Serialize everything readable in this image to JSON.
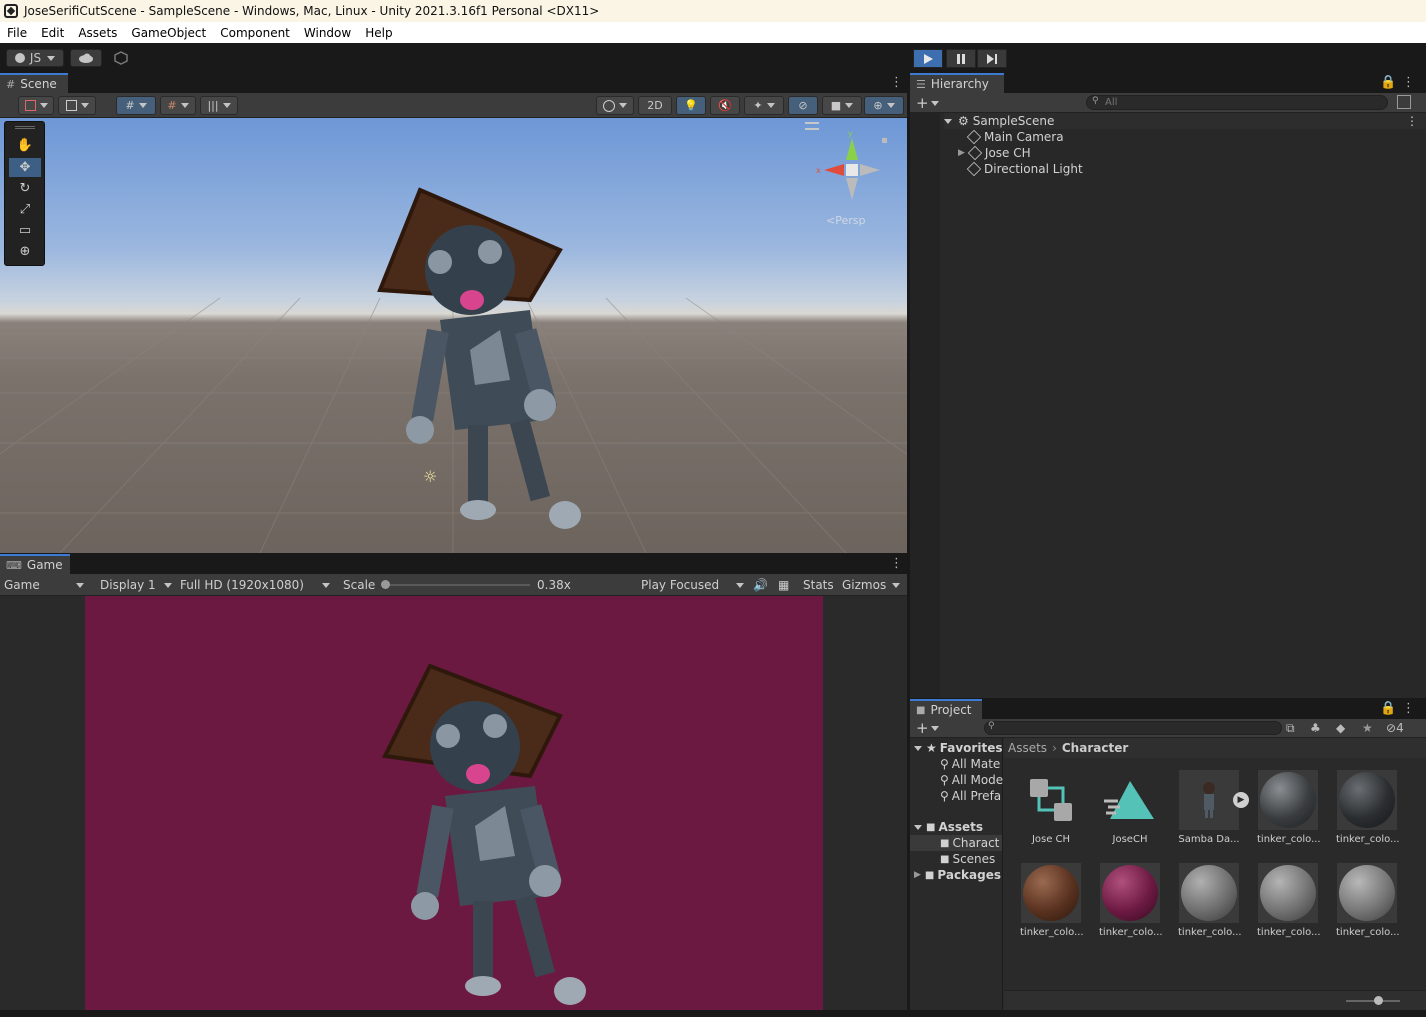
{
  "window": {
    "title": "JoseSerifiCutScene - SampleScene - Windows, Mac, Linux - Unity 2021.3.16f1 Personal <DX11>"
  },
  "menu": [
    "File",
    "Edit",
    "Assets",
    "GameObject",
    "Component",
    "Window",
    "Help"
  ],
  "toolbar": {
    "account_label": "JS",
    "play_icon": "play-icon",
    "pause_icon": "pause-icon",
    "step_icon": "step-icon"
  },
  "scene": {
    "tab_label": "Scene",
    "toggle_2d_label": "2D",
    "gizmo_axes": {
      "y": "y",
      "x": "x"
    },
    "gizmo_persp": "Persp"
  },
  "game": {
    "tab_label": "Game",
    "view_select": "Game",
    "display_select": "Display 1",
    "resolution_select": "Full HD (1920x1080)",
    "scale_label": "Scale",
    "scale_value_text": "0.38x",
    "scale_fraction": 0.0,
    "play_mode_select": "Play Focused",
    "stats_label": "Stats",
    "gizmos_label": "Gizmos"
  },
  "hierarchy": {
    "tab_label": "Hierarchy",
    "search_placeholder": "All",
    "scene_name": "SampleScene",
    "items": [
      {
        "label": "Main Camera",
        "has_children": false
      },
      {
        "label": "Jose CH",
        "has_children": true
      },
      {
        "label": "Directional Light",
        "has_children": false
      }
    ]
  },
  "project": {
    "tab_label": "Project",
    "hidden_count": "4",
    "favorites_label": "Favorites",
    "favorites": [
      "All Mate",
      "All Mode",
      "All Prefa"
    ],
    "assets_label": "Assets",
    "asset_folders": [
      "Charact",
      "Scenes"
    ],
    "packages_label": "Packages",
    "breadcrumb": [
      "Assets",
      "Character"
    ],
    "assets": [
      {
        "label": "Jose CH",
        "icon": "prefab-icon"
      },
      {
        "label": "JoseCH",
        "icon": "avatar-icon"
      },
      {
        "label": "Samba Da...",
        "icon": "animation-icon"
      },
      {
        "label": "tinker_colo...",
        "color": "#3a3d40"
      },
      {
        "label": "tinker_colo...",
        "color": "#2b2e31"
      },
      {
        "label": "tinker_colo...",
        "color": "#5a3220"
      },
      {
        "label": "tinker_colo...",
        "color": "#6d1a43"
      },
      {
        "label": "tinker_colo...",
        "color": "#6e6e6e"
      },
      {
        "label": "tinker_colo...",
        "color": "#727272"
      },
      {
        "label": "tinker_colo...",
        "color": "#767676"
      }
    ]
  }
}
